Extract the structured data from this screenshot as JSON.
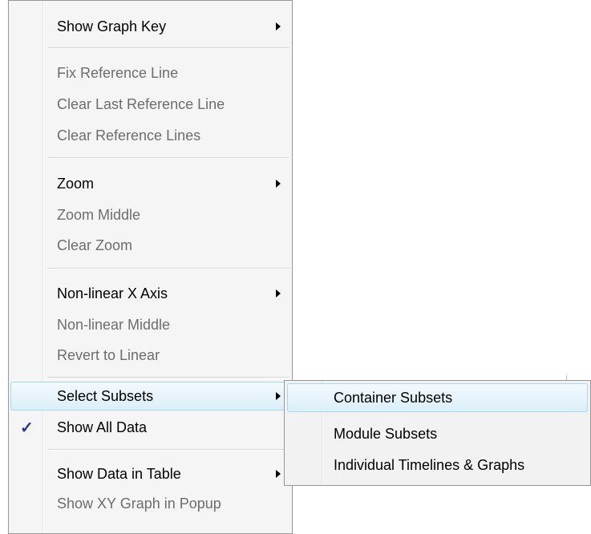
{
  "main_menu": {
    "items": [
      {
        "label": "Show Graph Key",
        "enabled": true,
        "submenu": true
      },
      {
        "label": "Fix Reference Line",
        "enabled": false
      },
      {
        "label": "Clear Last Reference Line",
        "enabled": false
      },
      {
        "label": "Clear Reference Lines",
        "enabled": false
      },
      {
        "label": "Zoom",
        "enabled": true,
        "submenu": true
      },
      {
        "label": "Zoom Middle",
        "enabled": false
      },
      {
        "label": "Clear Zoom",
        "enabled": false
      },
      {
        "label": "Non-linear X Axis",
        "enabled": true,
        "submenu": true
      },
      {
        "label": "Non-linear Middle",
        "enabled": false
      },
      {
        "label": "Revert to Linear",
        "enabled": false
      },
      {
        "label": "Select Subsets",
        "enabled": true,
        "submenu": true,
        "highlighted": true
      },
      {
        "label": "Show All Data",
        "enabled": true,
        "checked": true
      },
      {
        "label": "Show Data in Table",
        "enabled": true,
        "submenu": true
      },
      {
        "label": "Show XY Graph in Popup",
        "enabled": false
      }
    ],
    "check_glyph": "✓"
  },
  "submenu": {
    "items": [
      {
        "label": "Container Subsets",
        "highlighted": true
      },
      {
        "label": "Module Subsets"
      },
      {
        "label": "Individual Timelines & Graphs"
      }
    ]
  },
  "colors": {
    "highlight_border": "#a8d8eb",
    "disabled_text": "#6d6d6d",
    "check": "#2b3a8a"
  }
}
